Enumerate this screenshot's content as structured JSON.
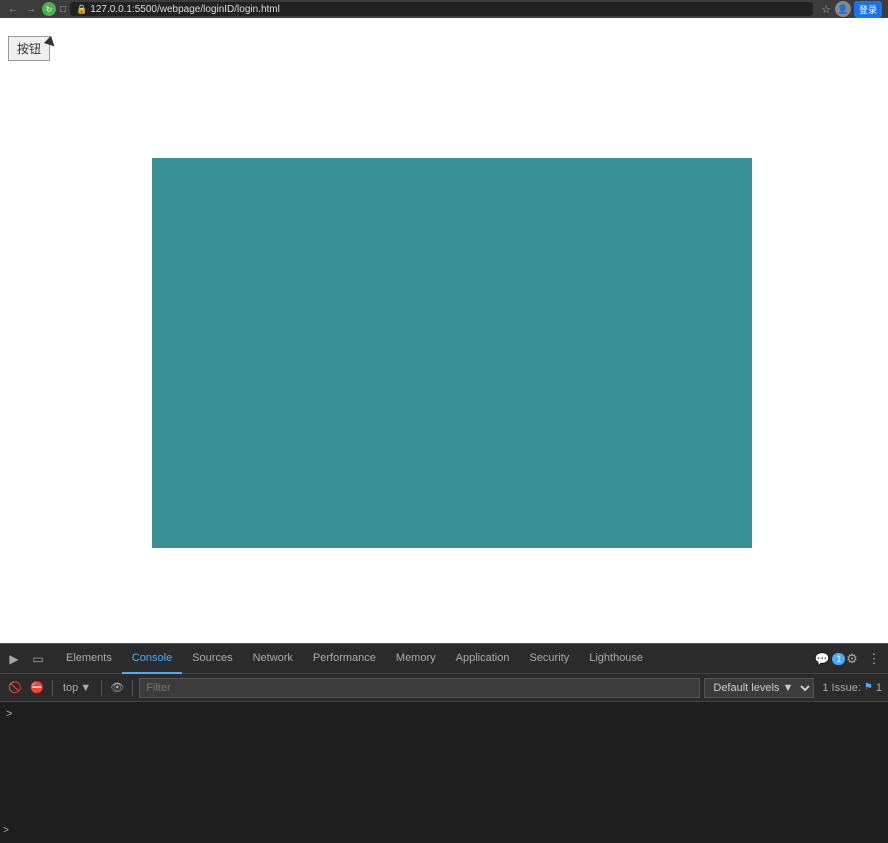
{
  "browser": {
    "url": "127.0.0.1:5500/webpage/loginID/login.html",
    "back_label": "←",
    "forward_label": "→",
    "lock_icon": "🔒",
    "star_icon": "☆",
    "signin_label": "登录",
    "refresh_icon": "↻"
  },
  "page": {
    "button_label": "按钮",
    "teal_color": "#3a8f96"
  },
  "devtools": {
    "tabs": [
      {
        "id": "elements",
        "label": "Elements",
        "active": false
      },
      {
        "id": "console",
        "label": "Console",
        "active": true
      },
      {
        "id": "sources",
        "label": "Sources",
        "active": false
      },
      {
        "id": "network",
        "label": "Network",
        "active": false
      },
      {
        "id": "performance",
        "label": "Performance",
        "active": false
      },
      {
        "id": "memory",
        "label": "Memory",
        "active": false
      },
      {
        "id": "application",
        "label": "Application",
        "active": false
      },
      {
        "id": "security",
        "label": "Security",
        "active": false
      },
      {
        "id": "lighthouse",
        "label": "Lighthouse",
        "active": false
      }
    ],
    "messages_badge": "1",
    "gear_icon": "⚙",
    "menu_icon": "⋮",
    "console_toolbar": {
      "context_label": "top",
      "filter_placeholder": "Filter",
      "levels_label": "Default levels",
      "issue_text": "1 Issue:",
      "issue_count": "1"
    }
  }
}
